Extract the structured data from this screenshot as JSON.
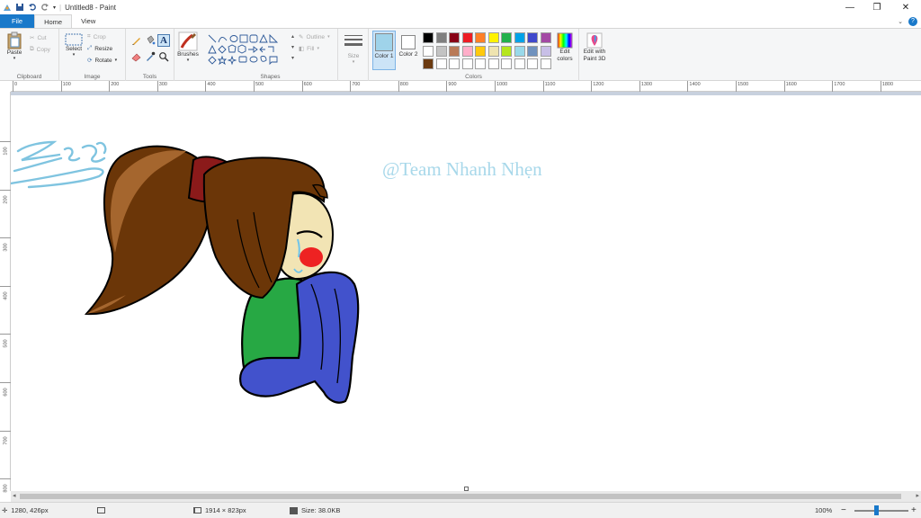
{
  "window": {
    "title": "Untitled8 - Paint",
    "minimize": "—",
    "maximize": "❐",
    "close": "✕"
  },
  "tabs": [
    {
      "label": "File"
    },
    {
      "label": "Home"
    },
    {
      "label": "View"
    }
  ],
  "ribbon": {
    "clipboard": {
      "label": "Clipboard",
      "paste": "Paste",
      "cut": "Cut",
      "copy": "Copy"
    },
    "image": {
      "label": "Image",
      "select": "Select",
      "crop": "Crop",
      "resize": "Resize",
      "rotate": "Rotate"
    },
    "tools": {
      "label": "Tools"
    },
    "brushes": {
      "label": "Brushes"
    },
    "shapes": {
      "label": "Shapes",
      "outline": "Outline",
      "fill": "Fill"
    },
    "size": {
      "label": "Size"
    },
    "colors": {
      "label": "Colors",
      "color1": "Color 1",
      "color2": "Color 2",
      "edit_colors": "Edit colors",
      "edit_paint3d": "Edit with Paint 3D",
      "color1_value": "#9fd3ea",
      "color2_value": "#ffffff",
      "palette_row1": [
        "#000000",
        "#7f7f7f",
        "#880015",
        "#ed1c24",
        "#ff7f27",
        "#fff200",
        "#22b14c",
        "#00a2e8",
        "#3f48cc",
        "#a349a4"
      ],
      "palette_row2": [
        "#ffffff",
        "#c3c3c3",
        "#b97a57",
        "#ffaec9",
        "#ffc90e",
        "#efe4b0",
        "#b5e61d",
        "#99d9ea",
        "#7092be",
        "#c8bfe7"
      ],
      "palette_row3_first": "#6b3a10"
    }
  },
  "ruler": {
    "top": [
      "0",
      "100",
      "200",
      "300",
      "400",
      "500",
      "600",
      "700",
      "800",
      "900",
      "1000",
      "1100",
      "1200",
      "1300",
      "1400",
      "1500",
      "1600",
      "1700",
      "1800"
    ],
    "left": [
      "100",
      "200",
      "300",
      "400",
      "500",
      "600",
      "700",
      "800"
    ]
  },
  "canvas": {
    "watermark": "@Team Nhanh Nhẹn",
    "signature": "Zero82"
  },
  "status": {
    "cursor": "1280, 426px",
    "dimensions": "1914 × 823px",
    "size": "Size: 38.0KB",
    "zoom": "100%",
    "zoom_out": "−",
    "zoom_in": "+"
  }
}
